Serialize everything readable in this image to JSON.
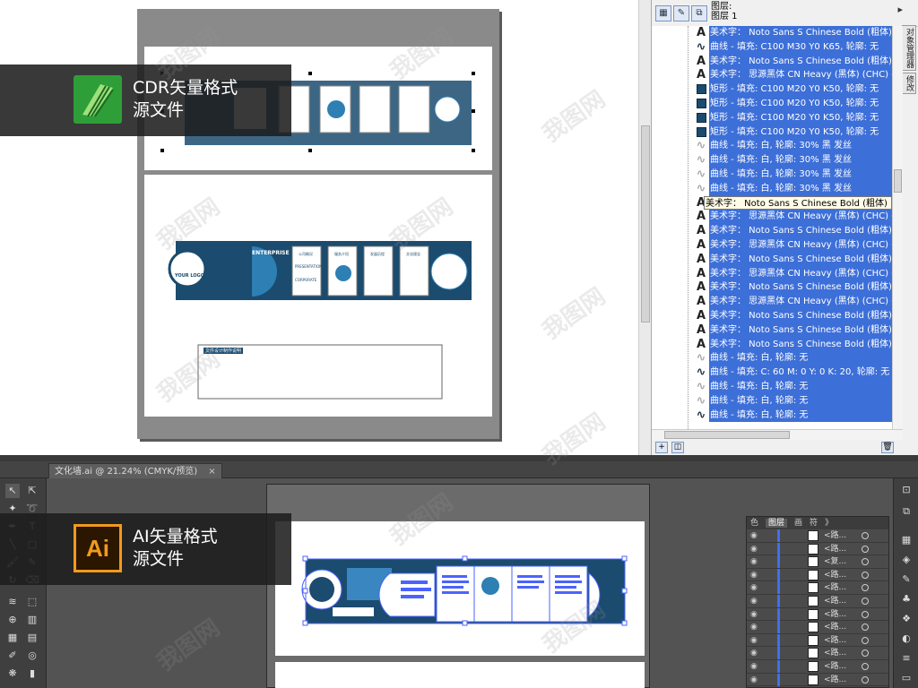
{
  "cdr": {
    "layer_title_1": "图层:",
    "layer_title_2": "图层 1",
    "side_tabs": [
      "对象管理器",
      "修改"
    ],
    "objects": [
      {
        "icon": "A",
        "kind": "text",
        "label": "美术字： Noto Sans S Chinese Bold (粗体) ("
      },
      {
        "icon": "curve",
        "kind": "curve",
        "label": "曲线 - 填充: C100 M30 Y0 K65, 轮廓: 无"
      },
      {
        "icon": "A",
        "kind": "text",
        "label": "美术字： Noto Sans S Chinese Bold (粗体) ("
      },
      {
        "icon": "A",
        "kind": "text",
        "label": "美术字： 思源黑体 CN Heavy (黑体) (CHC) -"
      },
      {
        "icon": "rect",
        "kind": "rect",
        "label": "矩形 - 填充: C100 M20 Y0 K50, 轮廓: 无"
      },
      {
        "icon": "rect",
        "kind": "rect",
        "label": "矩形 - 填充: C100 M20 Y0 K50, 轮廓: 无"
      },
      {
        "icon": "rect",
        "kind": "rect",
        "label": "矩形 - 填充: C100 M20 Y0 K50, 轮廓: 无"
      },
      {
        "icon": "rect",
        "kind": "rect",
        "label": "矩形 - 填充: C100 M20 Y0 K50, 轮廓: 无"
      },
      {
        "icon": "curve",
        "kind": "curve-white",
        "label": "曲线 - 填充: 白, 轮廓: 30% 黑 发丝"
      },
      {
        "icon": "curve",
        "kind": "curve-white",
        "label": "曲线 - 填充: 白, 轮廓: 30% 黑 发丝"
      },
      {
        "icon": "curve",
        "kind": "curve-white",
        "label": "曲线 - 填充: 白, 轮廓: 30% 黑 发丝"
      },
      {
        "icon": "curve",
        "kind": "curve-white",
        "label": "曲线 - 填充: 白, 轮廓: 30% 黑 发丝"
      },
      {
        "icon": "A",
        "kind": "tooltip",
        "label": "美术字： Noto Sans S Chinese Bold (粗体) (ENU) - 填"
      },
      {
        "icon": "A",
        "kind": "text",
        "label": "美术字： 思源黑体 CN Heavy (黑体) (CHC) -"
      },
      {
        "icon": "A",
        "kind": "text",
        "label": "美术字： Noto Sans S Chinese Bold (粗体) ("
      },
      {
        "icon": "A",
        "kind": "text",
        "label": "美术字： 思源黑体 CN Heavy (黑体) (CHC) -"
      },
      {
        "icon": "A",
        "kind": "text",
        "label": "美术字： Noto Sans S Chinese Bold (粗体) ("
      },
      {
        "icon": "A",
        "kind": "text",
        "label": "美术字： 思源黑体 CN Heavy (黑体) (CHC) -"
      },
      {
        "icon": "A",
        "kind": "text",
        "label": "美术字： Noto Sans S Chinese Bold (粗体) ("
      },
      {
        "icon": "A",
        "kind": "text",
        "label": "美术字： 思源黑体 CN Heavy (黑体) (CHC) -"
      },
      {
        "icon": "A",
        "kind": "text",
        "label": "美术字： Noto Sans S Chinese Bold (粗体) ("
      },
      {
        "icon": "A",
        "kind": "text",
        "label": "美术字： Noto Sans S Chinese Bold (粗体) ("
      },
      {
        "icon": "A",
        "kind": "text",
        "label": "美术字： Noto Sans S Chinese Bold (粗体) ("
      },
      {
        "icon": "curve",
        "kind": "curve-white",
        "label": "曲线 - 填充: 白, 轮廓: 无"
      },
      {
        "icon": "curve",
        "kind": "curve",
        "label": "曲线 - 填充: C: 60 M: 0 Y: 0 K: 20, 轮廓: 无"
      },
      {
        "icon": "curve",
        "kind": "curve-white",
        "label": "曲线 - 填充: 白, 轮廓: 无"
      },
      {
        "icon": "curve",
        "kind": "curve-white",
        "label": "曲线 - 填充: 白, 轮廓: 无"
      },
      {
        "icon": "curve",
        "kind": "curve",
        "label": "曲线 - 填充: 白, 轮廓: 无"
      }
    ],
    "page2_texts": {
      "logo": "YOUR LOGO",
      "enterprise": "ENTERPRISE",
      "presentation": "PRESENTATION",
      "corporate": "CORPORATE",
      "section_a": "公司概况",
      "section_b": "服务介绍",
      "section_c": "发展历程",
      "section_d": "文化理念",
      "notes_title": "文件设计制作说明"
    }
  },
  "badges": {
    "cdr_line1": "CDR矢量格式",
    "cdr_line2": "源文件",
    "ai_line1": "AI矢量格式",
    "ai_line2": "源文件",
    "ai_logo_text": "Ai"
  },
  "ai": {
    "tab_title": "文化墙.ai @ 21.24% (CMYK/预览)",
    "tab_close": "×",
    "panel_tabs": [
      "色",
      "图层",
      "画",
      "符",
      "》"
    ],
    "layers": [
      {
        "name": "<路..."
      },
      {
        "name": "<路..."
      },
      {
        "name": "<复..."
      },
      {
        "name": "<路..."
      },
      {
        "name": "<路..."
      },
      {
        "name": "<路..."
      },
      {
        "name": "<路..."
      },
      {
        "name": "<路..."
      },
      {
        "name": "<路..."
      },
      {
        "name": "<路..."
      },
      {
        "name": "<路..."
      },
      {
        "name": "<路..."
      }
    ]
  },
  "watermark": "我图网",
  "colors": {
    "brand_dark_blue": "#1b4b6e",
    "selection_blue": "#3d6fd8",
    "ai_orange": "#f19a1e",
    "cdr_green": "#2e9e38"
  }
}
